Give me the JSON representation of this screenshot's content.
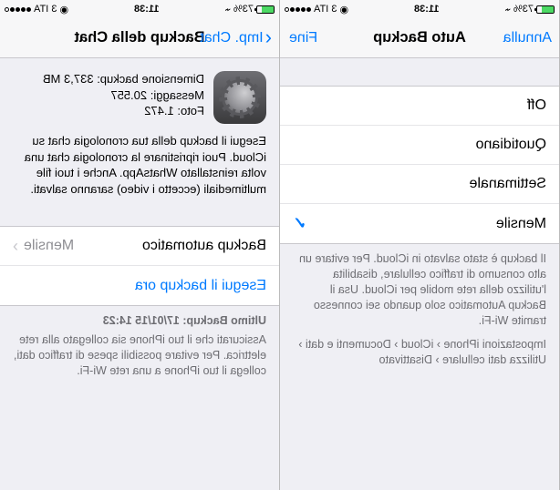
{
  "status": {
    "battery_pct": "73%",
    "carrier": "3 ITA",
    "time": "11:38"
  },
  "left": {
    "nav": {
      "back_label": "Imp. Chat",
      "title": "Backup della Chat"
    },
    "info": {
      "dim_label": "Dimensione backup:",
      "dim_value": "337,3 MB",
      "msg_label": "Messaggi:",
      "msg_value": "20.557",
      "foto_label": "Foto:",
      "foto_value": "1.472"
    },
    "desc": "Esegui il backup della tua cronologia chat su iCloud. Puoi ripristinare la cronologia chat una volta reinstallato WhatsApp. Anche i tuoi file multimediali (eccetto i video) saranno salvati.",
    "auto_label": "Backup automatico",
    "auto_value": "Mensile",
    "run_now": "Esegui il backup ora",
    "last_title": "Ultimo Backup: 17/01/15 14:23",
    "last_desc": "Assicurati che il tuo iPhone sia collegato alla rete elettrica. Per evitare possibili spese di traffico dati, collega il tuo iPhone a una rete Wi-Fi."
  },
  "right": {
    "nav": {
      "cancel": "Annulla",
      "title": "Auto Backup",
      "done": "Fine"
    },
    "options": {
      "off": "Off",
      "daily": "Quotidiano",
      "weekly": "Settimanale",
      "monthly": "Mensile"
    },
    "foot1": "Il backup è stato salvato in iCloud. Per evitare un alto consumo di traffico cellulare, disabilita l'utilizzo della rete mobile per iCloud. Usa il Backup Automatico solo quando sei connesso tramite Wi-Fi.",
    "foot2a": "Impostazioni iPhone › iCloud › Documenti e dati ›",
    "foot2b": "Utilizza dati cellulare › Disattivato"
  }
}
